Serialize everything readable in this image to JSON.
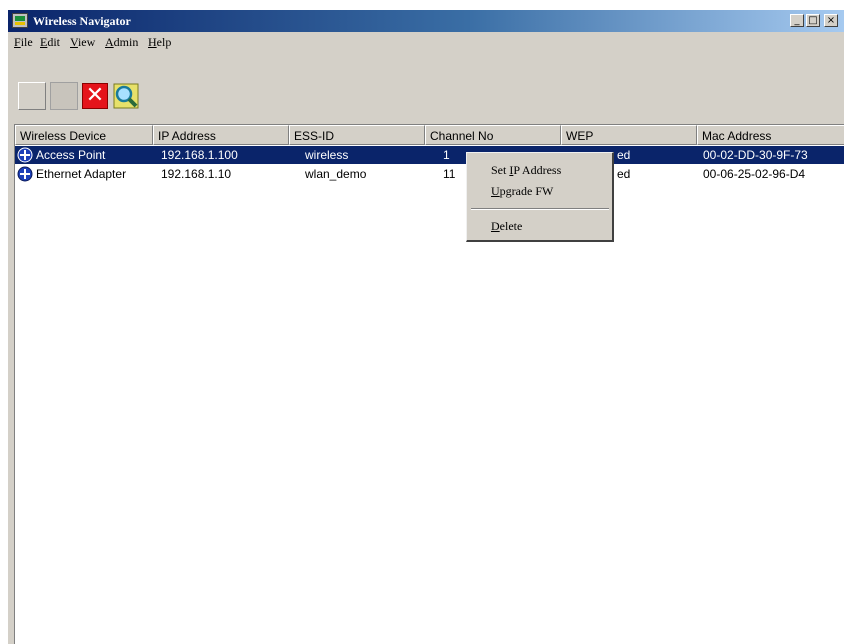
{
  "window": {
    "title": "Wireless Navigator",
    "controls": {
      "minimize": "_",
      "maximize": "□",
      "close": "×"
    }
  },
  "menu": {
    "items": [
      {
        "hotkey": "F",
        "rest": "ile"
      },
      {
        "hotkey": "E",
        "rest": "dit"
      },
      {
        "hotkey": "V",
        "rest": "iew"
      },
      {
        "hotkey": "A",
        "rest": "dmin"
      },
      {
        "hotkey": "H",
        "rest": "elp"
      }
    ]
  },
  "toolbar": {
    "icons": [
      "blank-icon",
      "disabled-icon",
      "delete-icon",
      "search-icon"
    ],
    "delete_glyph": "✕"
  },
  "table": {
    "columns": [
      "Wireless Device",
      "IP Address",
      "ESS-ID",
      "Channel No",
      "WEP",
      "Mac Address"
    ],
    "rows": [
      {
        "selected": true,
        "device": "Access Point",
        "ip": "192.168.1.100",
        "essid": "wireless",
        "channel": "1",
        "wep": "ed",
        "mac": "00-02-DD-30-9F-73"
      },
      {
        "selected": false,
        "device": "Ethernet Adapter",
        "ip": "192.168.1.10",
        "essid": "wlan_demo",
        "channel": "11",
        "wep": "ed",
        "mac": "00-06-25-02-96-D4"
      }
    ]
  },
  "context_menu": {
    "set_ip": {
      "before": "Set ",
      "hotkey": "I",
      "after": "P Address"
    },
    "upgrade": {
      "hotkey": "U",
      "rest": "pgrade FW"
    },
    "delete": {
      "hotkey": "D",
      "rest": "elete"
    }
  },
  "colors": {
    "selection": "#0a246a",
    "title_start": "#0a246a",
    "title_end": "#a6caf0",
    "device_icon": "#1c3fb8",
    "delete_red": "#e5141b"
  }
}
